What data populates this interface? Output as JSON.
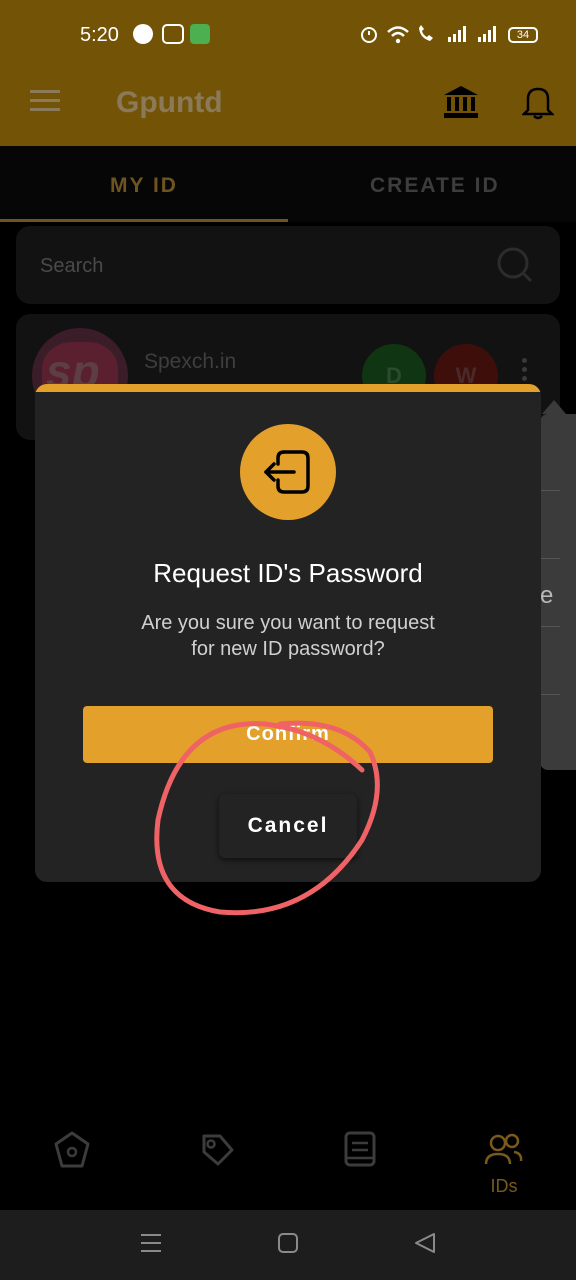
{
  "status_bar": {
    "time": "5:20",
    "battery": "34"
  },
  "app_bar": {
    "title": "Gpuntd"
  },
  "tabs": {
    "my_id": "MY ID",
    "create_id": "CREATE ID"
  },
  "search": {
    "placeholder": "Search"
  },
  "card": {
    "avatar_text": "sp",
    "site": "Spexch.in",
    "deposit_button": "D",
    "withdraw_button": "W"
  },
  "popup_menu": {
    "visible_fragment": "e"
  },
  "dialog": {
    "title": "Request ID's Password",
    "message": "Are you sure you want to request for new ID password?",
    "confirm_label": "Confirm",
    "cancel_label": "Cancel"
  },
  "bottom_nav": {
    "ids_label": "IDs"
  },
  "colors": {
    "accent": "#e3a02a",
    "dialog_bg": "#232323",
    "annotation": "#ef6366"
  }
}
